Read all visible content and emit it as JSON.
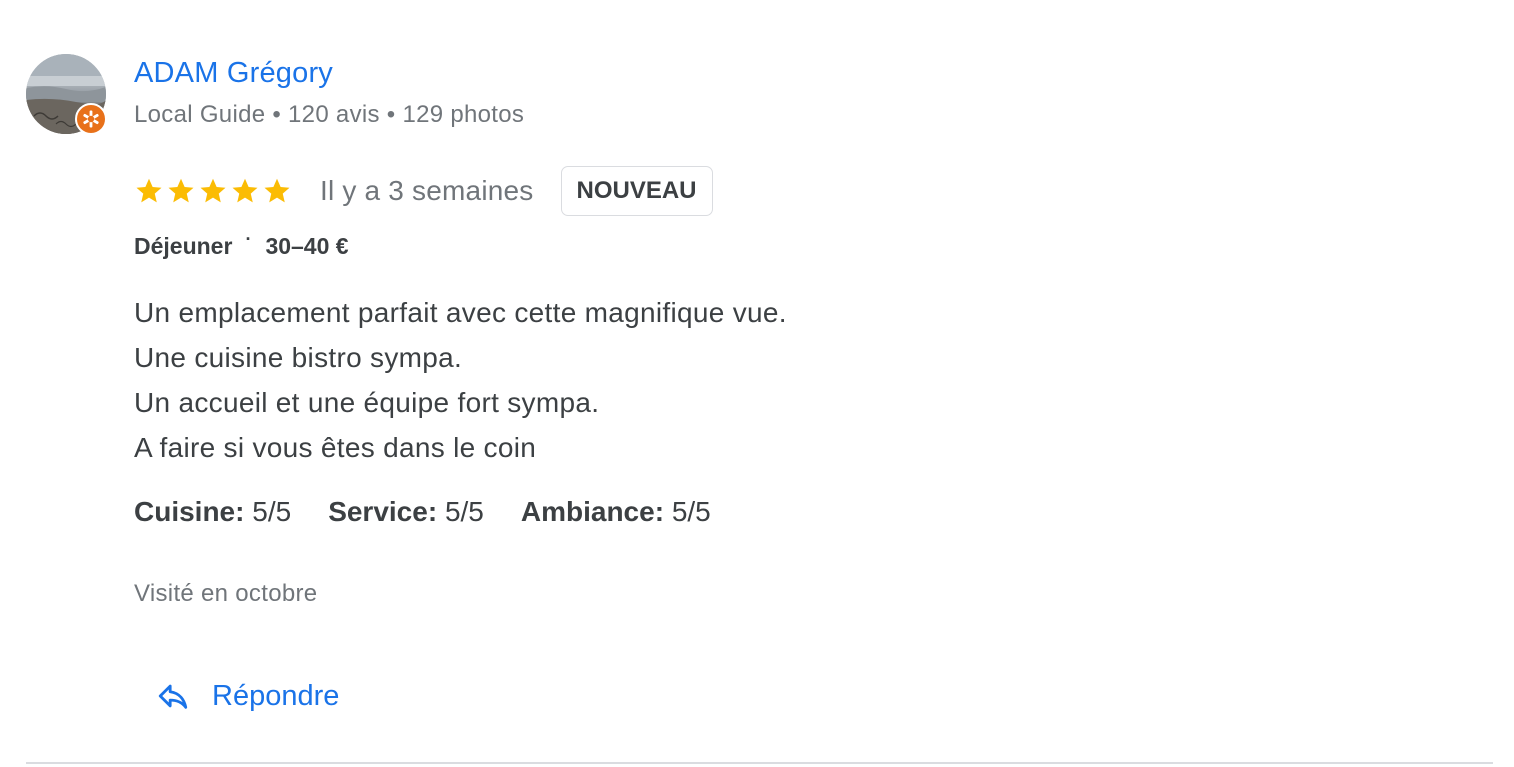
{
  "review": {
    "author": {
      "name": "ADAM Grégory",
      "meta": "Local Guide • 120 avis • 129 photos",
      "is_local_guide": true
    },
    "rating": {
      "stars": 5,
      "max_stars": 5,
      "star_color": "#fbbc04"
    },
    "date": "Il y a 3 semaines",
    "badge": "NOUVEAU",
    "meal": {
      "type": "Déjeuner",
      "separator": "·",
      "price": "30–40 €"
    },
    "text_lines": [
      "Un emplacement parfait avec cette magnifique vue.",
      "Une cuisine bistro sympa.",
      "Un accueil et une équipe fort sympa.",
      "A faire si vous êtes dans le coin"
    ],
    "subratings": [
      {
        "label": "Cuisine:",
        "value": "5/5"
      },
      {
        "label": "Service:",
        "value": "5/5"
      },
      {
        "label": "Ambiance:",
        "value": "5/5"
      }
    ],
    "visited": "Visité en octobre",
    "reply_label": "Répondre"
  },
  "colors": {
    "link_blue": "#1a73e8",
    "secondary_text": "#70757a",
    "primary_text": "#3c4043",
    "local_guide_orange": "#e8711a",
    "divider": "#dadce0"
  },
  "icons": {
    "avatar": "avatar-photo",
    "guide_badge": "local-guide-badge-icon",
    "star": "star-icon",
    "reply": "reply-arrow-icon"
  }
}
